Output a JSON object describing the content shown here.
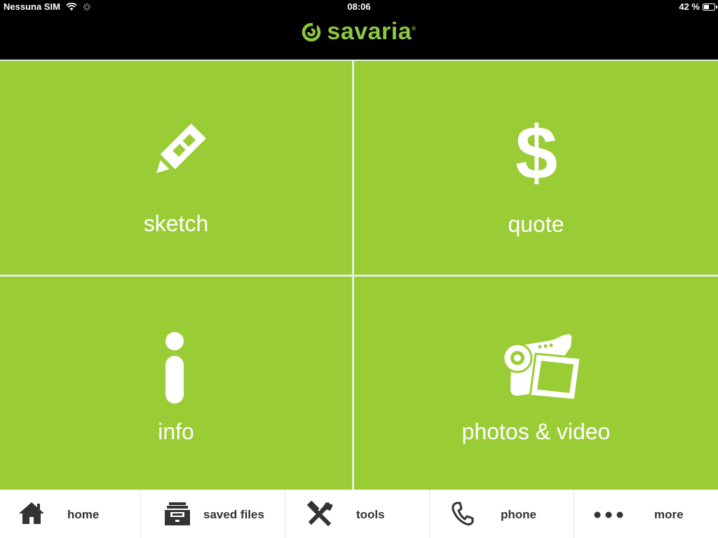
{
  "status_bar": {
    "carrier": "Nessuna SIM",
    "time": "08:06",
    "battery": "42 %",
    "battery_level": 0.42
  },
  "header": {
    "brand": "savaria",
    "brand_mark": "®",
    "brand_color": "#8dc63f"
  },
  "tiles": [
    {
      "label": "sketch",
      "icon": "pencil-icon"
    },
    {
      "label": "quote",
      "icon": "dollar-icon"
    },
    {
      "label": "info",
      "icon": "info-icon"
    },
    {
      "label": "photos & video",
      "icon": "video-camera-icon"
    }
  ],
  "tile_color": "#9acd35",
  "tabbar": {
    "items": [
      {
        "label": "home",
        "icon": "home-icon"
      },
      {
        "label": "saved files",
        "icon": "file-cabinet-icon"
      },
      {
        "label": "tools",
        "icon": "tools-icon"
      },
      {
        "label": "phone",
        "icon": "phone-icon"
      },
      {
        "label": "more",
        "icon": "more-icon"
      }
    ]
  }
}
